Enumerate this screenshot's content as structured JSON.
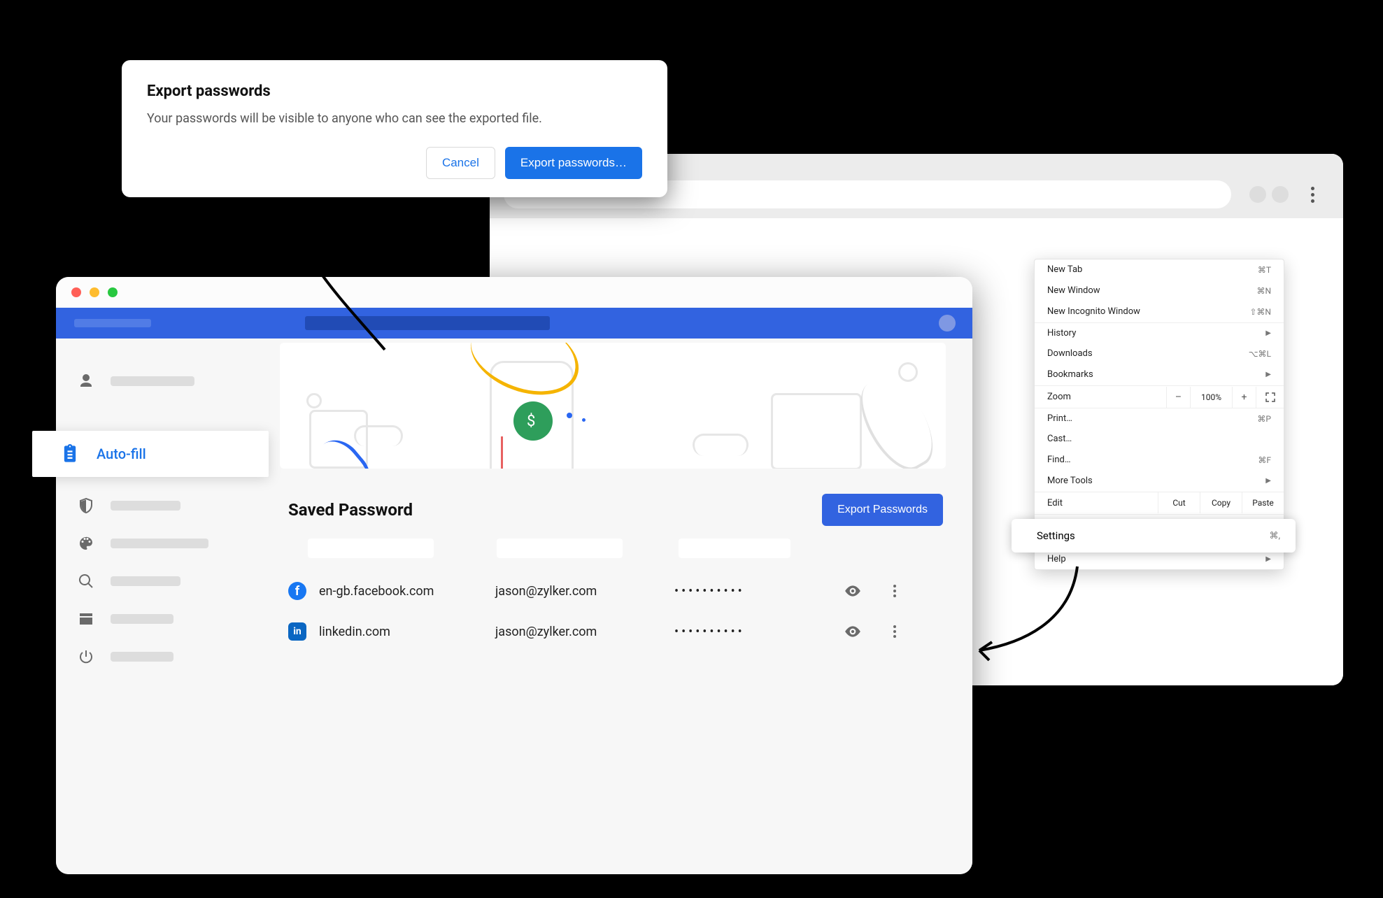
{
  "dialog": {
    "title": "Export passwords",
    "body": "Your passwords will be visible to anyone who can see the exported file.",
    "cancel": "Cancel",
    "confirm": "Export passwords…"
  },
  "chrome_menu": {
    "new_tab": {
      "label": "New Tab",
      "shortcut": "⌘T"
    },
    "new_window": {
      "label": "New Window",
      "shortcut": "⌘N"
    },
    "new_incognito": {
      "label": "New Incognito Window",
      "shortcut": "⇧⌘N"
    },
    "history": {
      "label": "History"
    },
    "downloads": {
      "label": "Downloads",
      "shortcut": "⌥⌘L"
    },
    "bookmarks": {
      "label": "Bookmarks"
    },
    "zoom": {
      "label": "Zoom",
      "value": "100%",
      "minus": "–",
      "plus": "+"
    },
    "print": {
      "label": "Print…",
      "shortcut": "⌘P"
    },
    "cast": {
      "label": "Cast…"
    },
    "find": {
      "label": "Find…",
      "shortcut": "⌘F"
    },
    "more_tools": {
      "label": "More Tools"
    },
    "edit": {
      "label": "Edit",
      "cut": "Cut",
      "copy": "Copy",
      "paste": "Paste"
    },
    "settings": {
      "label": "Settings",
      "shortcut": "⌘,"
    },
    "help": {
      "label": "Help"
    }
  },
  "sidebar": {
    "autofill": "Auto-fill"
  },
  "main": {
    "saved_title": "Saved Password",
    "export_button": "Export Passwords",
    "rows": [
      {
        "site": "en-gb.facebook.com",
        "user": "jason@zylker.com",
        "password": "••••••••••",
        "brand": "fb"
      },
      {
        "site": "linkedin.com",
        "user": "jason@zylker.com",
        "password": "••••••••••",
        "brand": "li"
      }
    ]
  }
}
